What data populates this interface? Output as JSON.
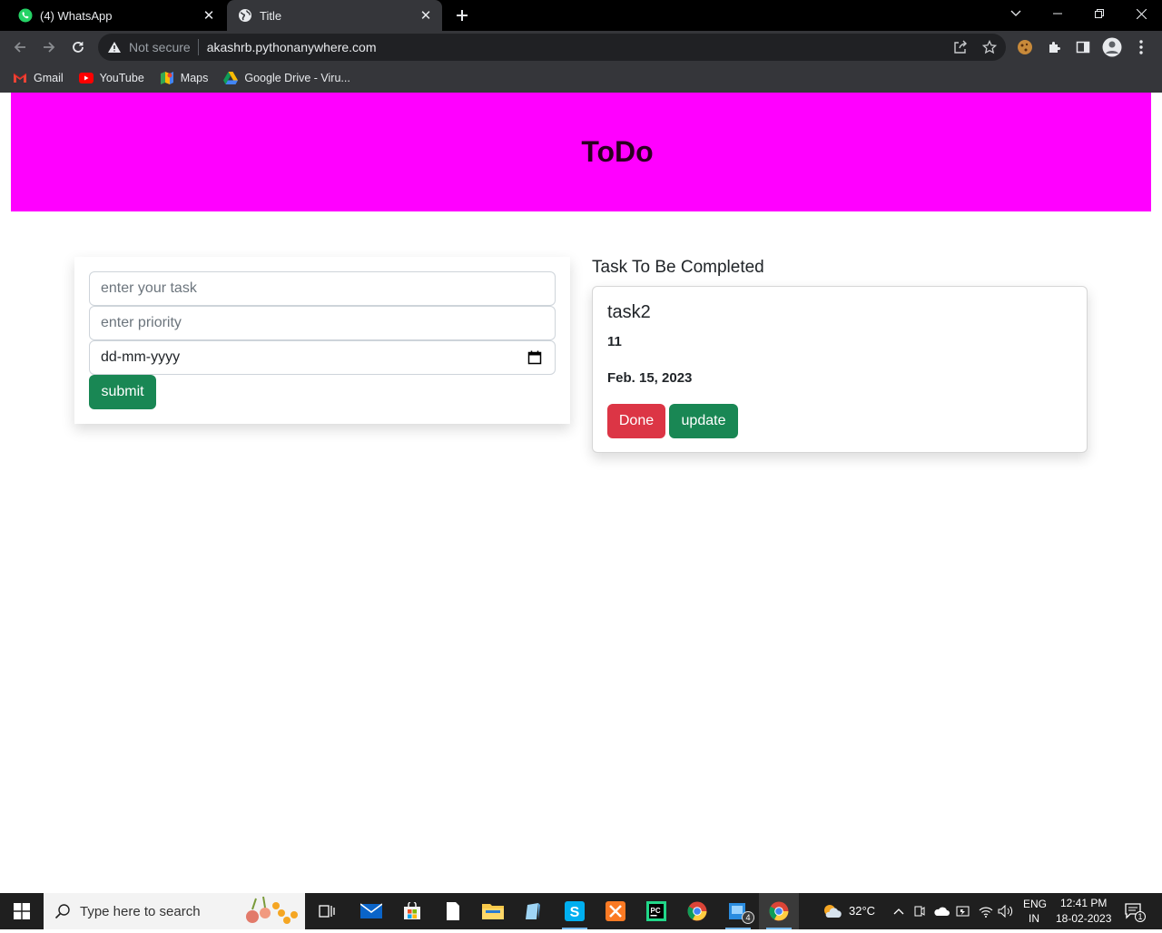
{
  "browser": {
    "tabs": [
      {
        "title": "(4) WhatsApp",
        "active": false
      },
      {
        "title": "Title",
        "active": true
      }
    ],
    "address": {
      "security_label": "Not secure",
      "url": "akashrb.pythonanywhere.com"
    },
    "bookmarks": [
      {
        "label": "Gmail",
        "icon": "gmail-icon"
      },
      {
        "label": "YouTube",
        "icon": "youtube-icon"
      },
      {
        "label": "Maps",
        "icon": "maps-icon"
      },
      {
        "label": "Google Drive - Viru...",
        "icon": "google-drive-icon"
      }
    ]
  },
  "page": {
    "header_title": "ToDo",
    "form": {
      "task_placeholder": "enter your task",
      "priority_placeholder": "enter priority",
      "date_placeholder": "dd-mm-yyyy",
      "submit_label": "submit"
    },
    "tasks_section_title": "Task To Be Completed",
    "tasks": [
      {
        "name": "task2",
        "priority": "11",
        "date": "Feb. 15, 2023",
        "done_label": "Done",
        "update_label": "update"
      }
    ]
  },
  "taskbar": {
    "search_placeholder": "Type here to search",
    "weather": "32°C",
    "language": "ENG",
    "region": "IN",
    "time": "12:41 PM",
    "date": "18-02-2023",
    "notification_count": "1",
    "store_badge": "4"
  },
  "colors": {
    "header_bg": "#ff00ff",
    "success": "#198754",
    "danger": "#dc3545"
  }
}
